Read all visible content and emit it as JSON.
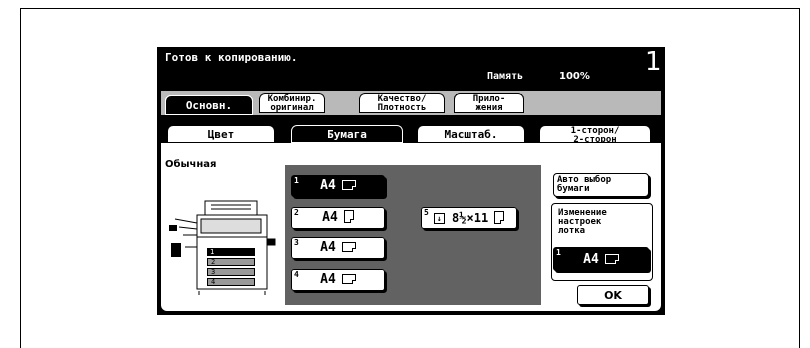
{
  "status": {
    "message": "Готов к копированию.",
    "memory_label": "Память",
    "memory_value": "100%",
    "copies": "1"
  },
  "main_tabs": [
    {
      "label": "Основн.",
      "active": true
    },
    {
      "label_line1": "Комбинир.",
      "label_line2": "оригинал"
    },
    {
      "label_line1": "Качество/",
      "label_line2": "Плотность"
    },
    {
      "label_line1": "Прило-",
      "label_line2": "жения"
    }
  ],
  "sub_tabs": [
    {
      "label": "Цвет"
    },
    {
      "label": "Бумага",
      "active": true
    },
    {
      "label": "Масштаб."
    },
    {
      "label_line1": "1-сторон/",
      "label_line2": "2-сторон"
    }
  ],
  "paper_type": "Обычная",
  "trays": [
    {
      "num": "1",
      "label": "A4",
      "orientation": "landscape",
      "selected": true
    },
    {
      "num": "2",
      "label": "A4",
      "orientation": "portrait",
      "selected": false
    },
    {
      "num": "3",
      "label": "A4",
      "orientation": "landscape",
      "selected": false
    },
    {
      "num": "4",
      "label": "A4",
      "orientation": "landscape",
      "selected": false
    }
  ],
  "bypass_tray": {
    "num": "5",
    "label": "8½×11"
  },
  "machine_tray_labels": [
    "1",
    "2",
    "3",
    "4"
  ],
  "side_buttons": {
    "auto_paper_line1": "Авто выбор",
    "auto_paper_line2": "бумаги",
    "change_tray_line1": "Изменение",
    "change_tray_line2": "настроек",
    "change_tray_line3": "лотка",
    "current_tray_num": "1",
    "current_tray_label": "A4",
    "ok": "OK"
  }
}
